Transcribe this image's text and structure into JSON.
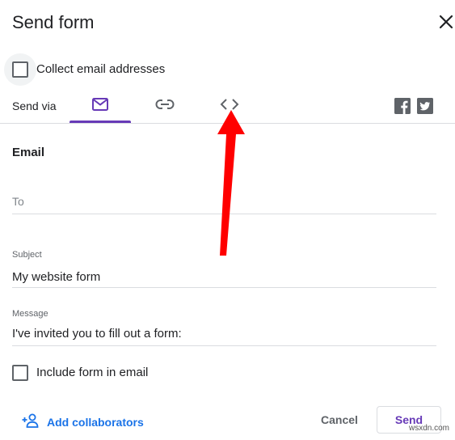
{
  "dialog": {
    "title": "Send form"
  },
  "collect_email": {
    "label": "Collect email addresses",
    "checked": false
  },
  "send_via": {
    "label": "Send via",
    "tabs": [
      {
        "icon": "email-icon",
        "selected": true
      },
      {
        "icon": "link-icon",
        "selected": false
      },
      {
        "icon": "embed-code-icon",
        "selected": false
      }
    ],
    "social": [
      "facebook-icon",
      "twitter-icon"
    ]
  },
  "email": {
    "section_title": "Email",
    "to_placeholder": "To",
    "subject_label": "Subject",
    "subject_value": "My website form",
    "message_label": "Message",
    "message_value": "I've invited you to fill out a form:",
    "include_form_label": "Include form in email"
  },
  "footer": {
    "add_collaborators": "Add collaborators",
    "cancel": "Cancel",
    "send": "Send"
  },
  "colors": {
    "accent": "#673ab7",
    "link": "#1a73e8",
    "annotation_arrow": "#ff0000"
  },
  "watermark": "wsxdn.com"
}
